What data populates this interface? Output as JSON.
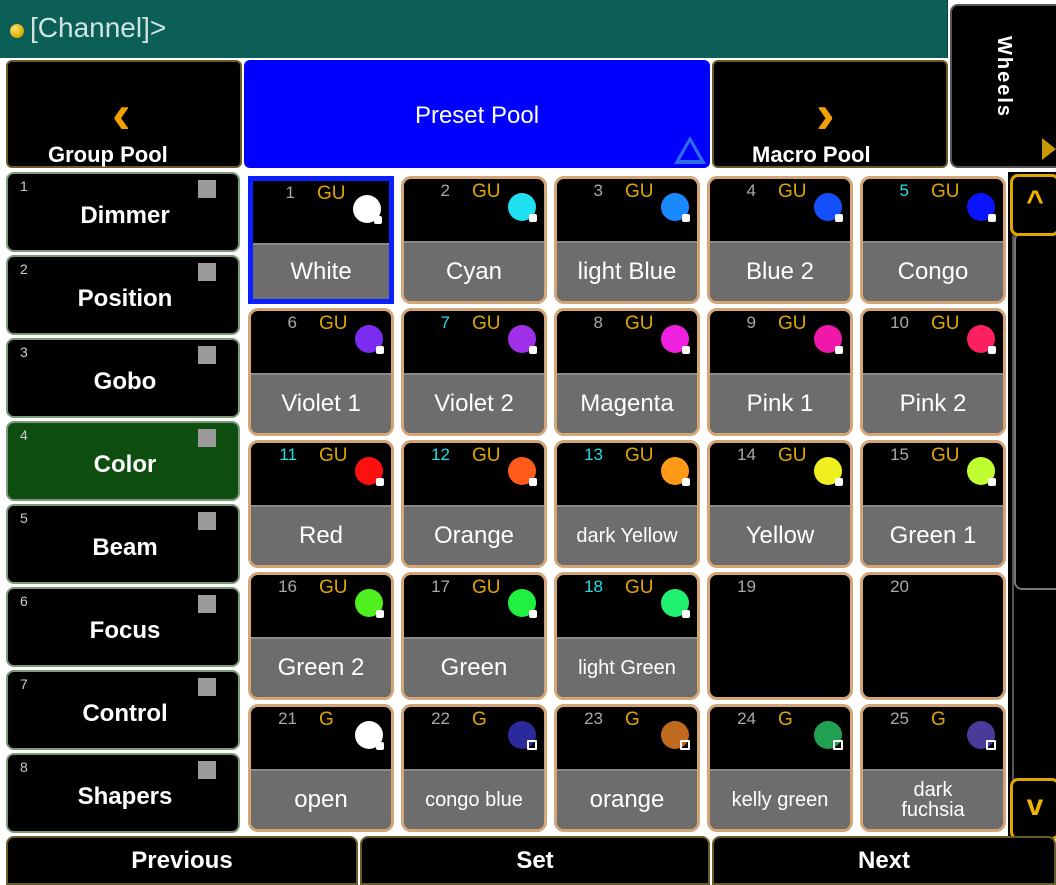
{
  "command_line": {
    "text": "[Channel]>"
  },
  "wheels_tab": {
    "label": "Wheels"
  },
  "nav": {
    "previous_pool": "Group Pool",
    "current_pool": "Preset Pool",
    "next_pool": "Macro Pool"
  },
  "preset_types": [
    {
      "num": "1",
      "label": "Dimmer"
    },
    {
      "num": "2",
      "label": "Position"
    },
    {
      "num": "3",
      "label": "Gobo"
    },
    {
      "num": "4",
      "label": "Color"
    },
    {
      "num": "5",
      "label": "Beam"
    },
    {
      "num": "6",
      "label": "Focus"
    },
    {
      "num": "7",
      "label": "Control"
    },
    {
      "num": "8",
      "label": "Shapers"
    }
  ],
  "presets": [
    {
      "num": "1",
      "tag": "GU",
      "name": "White",
      "color": "#ffffff"
    },
    {
      "num": "2",
      "tag": "GU",
      "name": "Cyan",
      "color": "#1fe0f0"
    },
    {
      "num": "3",
      "tag": "GU",
      "name": "light Blue",
      "color": "#1a88ff"
    },
    {
      "num": "4",
      "tag": "GU",
      "name": "Blue 2",
      "color": "#1550ff"
    },
    {
      "num": "5",
      "tag": "GU",
      "name": "Congo",
      "color": "#0a14ff"
    },
    {
      "num": "6",
      "tag": "GU",
      "name": "Violet 1",
      "color": "#7a2cf0"
    },
    {
      "num": "7",
      "tag": "GU",
      "name": "Violet 2",
      "color": "#a030e8"
    },
    {
      "num": "8",
      "tag": "GU",
      "name": "Magenta",
      "color": "#f020e0"
    },
    {
      "num": "9",
      "tag": "GU",
      "name": "Pink 1",
      "color": "#f018a8"
    },
    {
      "num": "10",
      "tag": "GU",
      "name": "Pink 2",
      "color": "#ff2060"
    },
    {
      "num": "11",
      "tag": "GU",
      "name": "Red",
      "color": "#ff1010"
    },
    {
      "num": "12",
      "tag": "GU",
      "name": "Orange",
      "color": "#ff5a1a"
    },
    {
      "num": "13",
      "tag": "GU",
      "name": "dark Yellow",
      "color": "#ff9a18"
    },
    {
      "num": "14",
      "tag": "GU",
      "name": "Yellow",
      "color": "#f0f020"
    },
    {
      "num": "15",
      "tag": "GU",
      "name": "Green 1",
      "color": "#c0ff30"
    },
    {
      "num": "16",
      "tag": "GU",
      "name": "Green 2",
      "color": "#50f020"
    },
    {
      "num": "17",
      "tag": "GU",
      "name": "Green",
      "color": "#20f040"
    },
    {
      "num": "18",
      "tag": "GU",
      "name": "light Green",
      "color": "#20f070"
    },
    {
      "num": "19",
      "tag": "",
      "name": "",
      "color": ""
    },
    {
      "num": "20",
      "tag": "",
      "name": "",
      "color": ""
    },
    {
      "num": "21",
      "tag": "G",
      "name": "open",
      "color": "#ffffff"
    },
    {
      "num": "22",
      "tag": "G",
      "name": "congo blue",
      "color": "#2a2a9a"
    },
    {
      "num": "23",
      "tag": "G",
      "name": "orange",
      "color": "#c06a20"
    },
    {
      "num": "24",
      "tag": "G",
      "name": "kelly green",
      "color": "#20a050"
    },
    {
      "num": "25",
      "tag": "G",
      "name": "dark fuchsia",
      "color": "#4a3a9a"
    }
  ],
  "scroll": {
    "up": "^",
    "down": "v"
  },
  "bottom": {
    "previous": "Previous",
    "set": "Set",
    "next": "Next"
  }
}
